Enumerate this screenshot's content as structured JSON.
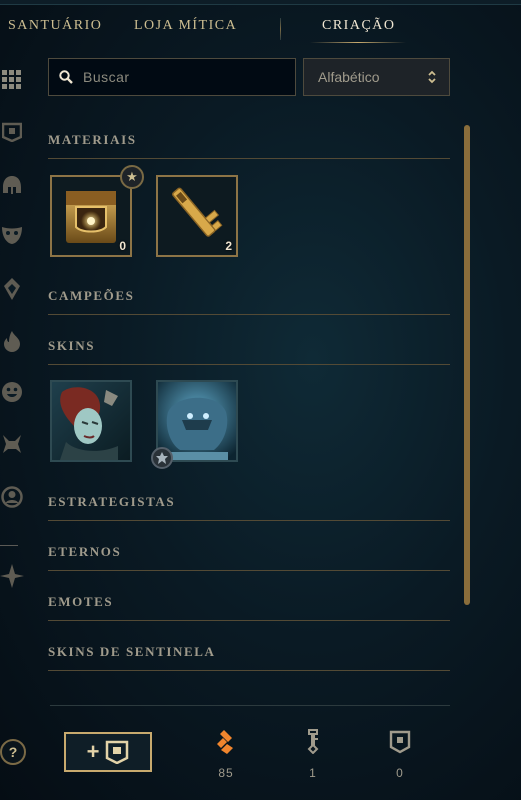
{
  "nav": {
    "tabs": [
      {
        "label": "SANTUÁRIO"
      },
      {
        "label": "LOJA MÍTICA"
      },
      {
        "label": "CRIAÇÃO"
      }
    ]
  },
  "sidebar": {
    "icons": [
      "grid-icon",
      "chest-icon",
      "champion-helmet-icon",
      "mask-icon",
      "ward-icon",
      "flame-icon",
      "emote-face-icon",
      "companion-icon",
      "profile-icon",
      "tft-icon"
    ],
    "help_label": "?"
  },
  "search": {
    "placeholder": "Buscar",
    "value": ""
  },
  "sort": {
    "selected": "Alfabético"
  },
  "categories": {
    "materiais": "MATERIAIS",
    "campeoes": "CAMPEÕES",
    "skins": "SKINS",
    "estrategistas": "ESTRATEGISTAS",
    "eternos": "ETERNOS",
    "emotes": "EMOTES",
    "sentinela": "SKINS DE SENTINELA"
  },
  "materials": [
    {
      "name": "hextech-chest",
      "count": "0"
    },
    {
      "name": "key-fragment",
      "count": "2"
    }
  ],
  "skins": [
    {
      "name": "skin-shard-1"
    },
    {
      "name": "skin-shard-2"
    }
  ],
  "currencies": [
    {
      "icon": "orange-essence-icon",
      "value": "85"
    },
    {
      "icon": "key-icon",
      "value": "1"
    },
    {
      "icon": "chest-icon",
      "value": "0"
    }
  ],
  "colors": {
    "gold": "#c8aa6e",
    "orange_essence": "#f0852d",
    "text": "#a09b8c"
  }
}
